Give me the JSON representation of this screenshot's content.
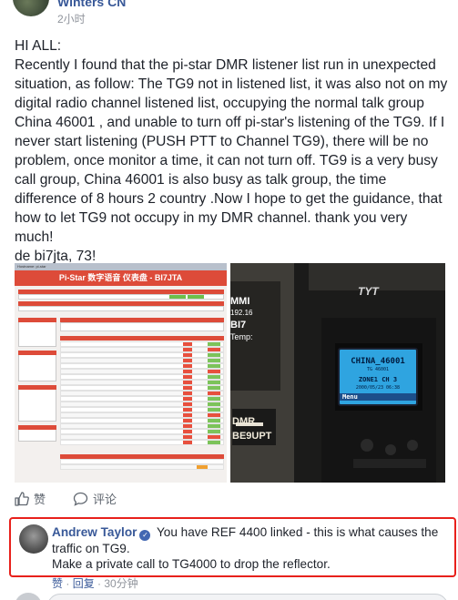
{
  "post": {
    "author": "Winters CN",
    "time": "2小时",
    "body": "HI ALL:\nRecently I found that the pi-star DMR listener list run in unexpected situation, as follow: The TG9 not in listened list, it was also not on my digital radio channel listened list, occupying the normal talk group China 46001 , and unable to turn off pi-star's listening of the TG9. If I never start listening (PUSH PTT to Channel TG9), there will be no problem, once monitor a time, it can not turn off. TG9 is a very busy call group, China 46001 is also busy as talk group, the time difference of 8 hours 2 country .Now I hope to get the guidance, that how to let TG9 not occupy in my DMR channel. thank you very much!\nde bi7jta, 73!"
  },
  "screenshot_left": {
    "banner": "Hostname: pi-star",
    "title": "Pi-Star 数字语音 仪表盘 - BI7JTA"
  },
  "screenshot_right": {
    "radio_brand": "TYT",
    "screen_line1": "CHINA_46001",
    "screen_line2": "TG 46001",
    "screen_line3": "ZONE1   CH 3",
    "screen_line4": "2000/05/23  06:38",
    "screen_menu": "Menu",
    "side_text1": "MMI",
    "side_text2": "192.16",
    "side_text3": "BI7",
    "side_text4": "Temp:",
    "dmr_text": "DMR",
    "callsign_text": "BE9UPT"
  },
  "actions": {
    "like": "赞",
    "comment": "评论"
  },
  "comment": {
    "author": "Andrew Taylor",
    "text1": " You have REF 4400 linked - this is what causes the traffic on TG9.",
    "text2": "Make a private call to TG4000 to drop the reflector.",
    "like": "赞",
    "reply": "回复",
    "separator": " · ",
    "time": "30分钟"
  },
  "colors": {
    "link": "#385898",
    "highlight_border": "#e8201b",
    "pistar_red": "#dd4b39",
    "radio_screen": "#2fa4e0"
  }
}
